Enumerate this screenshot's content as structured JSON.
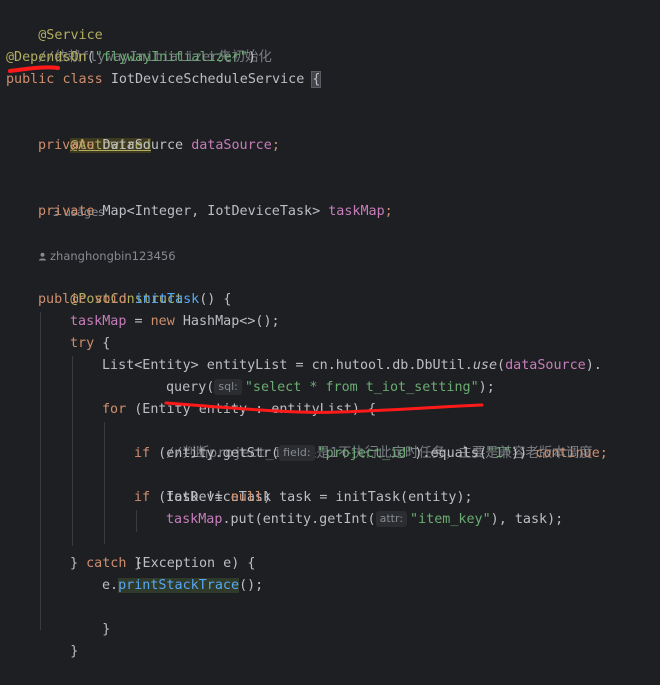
{
  "code": {
    "l1_annotation": "@Service",
    "l2_comment": "//依赖flywayInitializer先初始化",
    "l3_annotation": "@DependsOn",
    "l3_open": "(",
    "l3_string": "\"flywayInitializer\"",
    "l3_close": ")",
    "l4_kw_public": "public",
    "l4_kw_class": "class",
    "l4_classname": "IotDeviceScheduleService",
    "l4_brace": "{",
    "l6_annotation": "@Autowired",
    "l7_kw": "private",
    "l7_type": "DataSource",
    "l7_field": "dataSource",
    "l7_semi": ";",
    "l8_usages": "3 usages",
    "l9_kw": "private",
    "l9_type": "Map<Integer, IotDeviceTask>",
    "l9_field": "taskMap",
    "l9_semi": ";",
    "l10_author": "zhanghongbin123456",
    "l11_annotation": "@PostConstruct",
    "l12_kw_public": "public",
    "l12_kw_void": "void",
    "l12_method": "initTask",
    "l12_rest": "() {",
    "l13_field": "taskMap",
    "l13_eq": " = ",
    "l13_kw_new": "new",
    "l13_rest": " HashMap<>();",
    "l14_kw_try": "try",
    "l14_rest": " {",
    "l15_text": "List<Entity> entityList = cn.hutool.db.DbUtil.",
    "l15_use": "use",
    "l15_open": "(",
    "l15_field": "dataSource",
    "l15_close": ").",
    "l16_query": "query(",
    "l16_hint": "sql:",
    "l16_string": "\"select * from t_iot_setting\"",
    "l16_close": ");",
    "l17_kw_for": "for",
    "l17_rest": " (Entity entity : entityList) {",
    "l18_comment": "//判断project_id如果是1不执行此定时任务，主要是兼容老版本调度",
    "l19_kw_if": "if",
    "l19_text1": " (entity.getStr(",
    "l19_hint": "field:",
    "l19_string1": "\"project_id\"",
    "l19_text2": ").equals(",
    "l19_string2": "\"1\"",
    "l19_text3": ")) ",
    "l19_kw_continue": "continue",
    "l19_semi": ";",
    "l20_text": "IotDeviceTask task = initTask(entity);",
    "l21_kw_if": "if",
    "l21_text": " (task != ",
    "l21_kw_null": "null",
    "l21_close": ")",
    "l22_field": "taskMap",
    "l22_text1": ".put(entity.getInt(",
    "l22_hint": "attr:",
    "l22_string": "\"item_key\"",
    "l22_text2": "), task);",
    "l23_brace": "}",
    "l24_brace": "} ",
    "l24_kw_catch": "catch",
    "l24_rest": " (Exception e) {",
    "l25_text": "e.",
    "l25_method": "printStackTrace",
    "l25_rest": "();",
    "l26_brace": "}",
    "l27_brace": "}"
  },
  "colors": {
    "background": "#1e1f22",
    "keyword": "#cf8e6d",
    "annotation": "#b3ae60",
    "field": "#c77dbb",
    "string": "#6aab73",
    "comment": "#7a7e85",
    "method": "#56a8f5",
    "red_markup": "#ff1a1a"
  },
  "icons": {
    "author": "user-icon"
  }
}
